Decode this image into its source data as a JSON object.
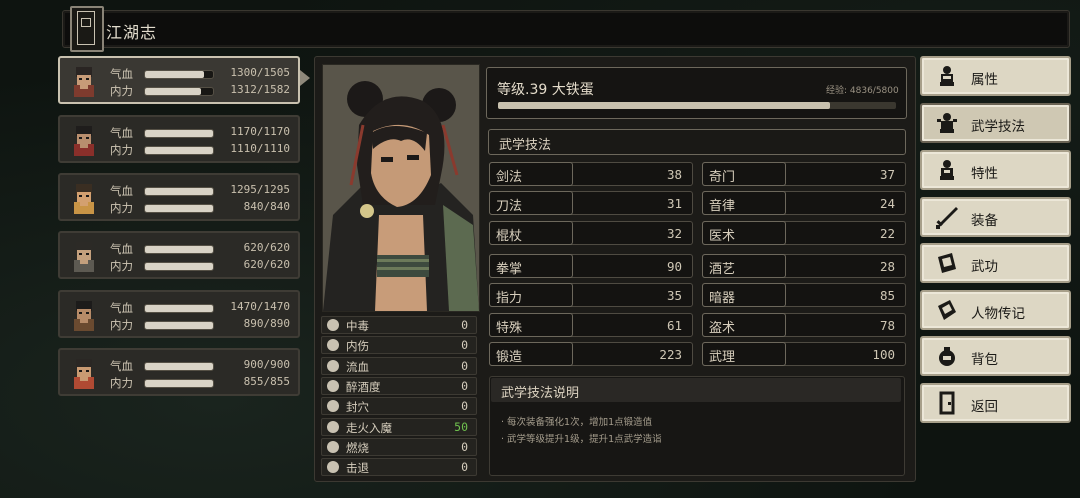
{
  "window": {
    "title": "江湖志"
  },
  "characters": [
    {
      "hp_label": "气血",
      "hp": "1300/1505",
      "hp_frac": 0.864,
      "mp_label": "内力",
      "mp": "1312/1582",
      "mp_frac": 0.829
    },
    {
      "hp_label": "气血",
      "hp": "1170/1170",
      "hp_frac": 1.0,
      "mp_label": "内力",
      "mp": "1110/1110",
      "mp_frac": 1.0
    },
    {
      "hp_label": "气血",
      "hp": "1295/1295",
      "hp_frac": 1.0,
      "mp_label": "内力",
      "mp": "840/840",
      "mp_frac": 1.0
    },
    {
      "hp_label": "气血",
      "hp": "620/620",
      "hp_frac": 1.0,
      "mp_label": "内力",
      "mp": "620/620",
      "mp_frac": 1.0
    },
    {
      "hp_label": "气血",
      "hp": "1470/1470",
      "hp_frac": 1.0,
      "mp_label": "内力",
      "mp": "890/890",
      "mp_frac": 1.0
    },
    {
      "hp_label": "气血",
      "hp": "900/900",
      "hp_frac": 1.0,
      "mp_label": "内力",
      "mp": "855/855",
      "mp_frac": 1.0
    }
  ],
  "profile": {
    "level_text": "等级.39 大铁蛋",
    "exp_text": "经验: 4836/5800",
    "exp_frac": 0.834
  },
  "status_effects": [
    {
      "name": "中毒",
      "value": "0"
    },
    {
      "name": "内伤",
      "value": "0"
    },
    {
      "name": "流血",
      "value": "0"
    },
    {
      "name": "醉酒度",
      "value": "0"
    },
    {
      "name": "封穴",
      "value": "0"
    },
    {
      "name": "走火入魔",
      "value": "50",
      "color": "#6fc04e"
    },
    {
      "name": "燃烧",
      "value": "0"
    },
    {
      "name": "击退",
      "value": "0"
    }
  ],
  "skills_section": {
    "title": "武学技法"
  },
  "skills_left": [
    {
      "name": "剑法",
      "value": "38"
    },
    {
      "name": "刀法",
      "value": "31"
    },
    {
      "name": "棍杖",
      "value": "32"
    },
    {
      "name": "拳掌",
      "value": "90"
    },
    {
      "name": "指力",
      "value": "35"
    },
    {
      "name": "特殊",
      "value": "61"
    },
    {
      "name": "锻造",
      "value": "223"
    }
  ],
  "skills_right": [
    {
      "name": "奇门",
      "value": "37"
    },
    {
      "name": "音律",
      "value": "24"
    },
    {
      "name": "医术",
      "value": "22"
    },
    {
      "name": "酒艺",
      "value": "28"
    },
    {
      "name": "暗器",
      "value": "85"
    },
    {
      "name": "盗术",
      "value": "78"
    },
    {
      "name": "武理",
      "value": "100"
    }
  ],
  "description": {
    "title": "武学技法说明",
    "lines": [
      "· 每次装备强化1次，增加1点锻造值",
      "· 武学等级提升1级，提升1点武学造诣"
    ]
  },
  "menu": [
    {
      "label": "属性",
      "icon": "person-icon"
    },
    {
      "label": "武学技法",
      "icon": "martial-person-icon",
      "active": true
    },
    {
      "label": "特性",
      "icon": "trait-person-icon"
    },
    {
      "label": "装备",
      "icon": "sword-icon"
    },
    {
      "label": "武功",
      "icon": "scroll-book-icon"
    },
    {
      "label": "人物传记",
      "icon": "biography-book-icon"
    },
    {
      "label": "背包",
      "icon": "bag-icon"
    },
    {
      "label": "返回",
      "icon": "door-icon"
    }
  ]
}
